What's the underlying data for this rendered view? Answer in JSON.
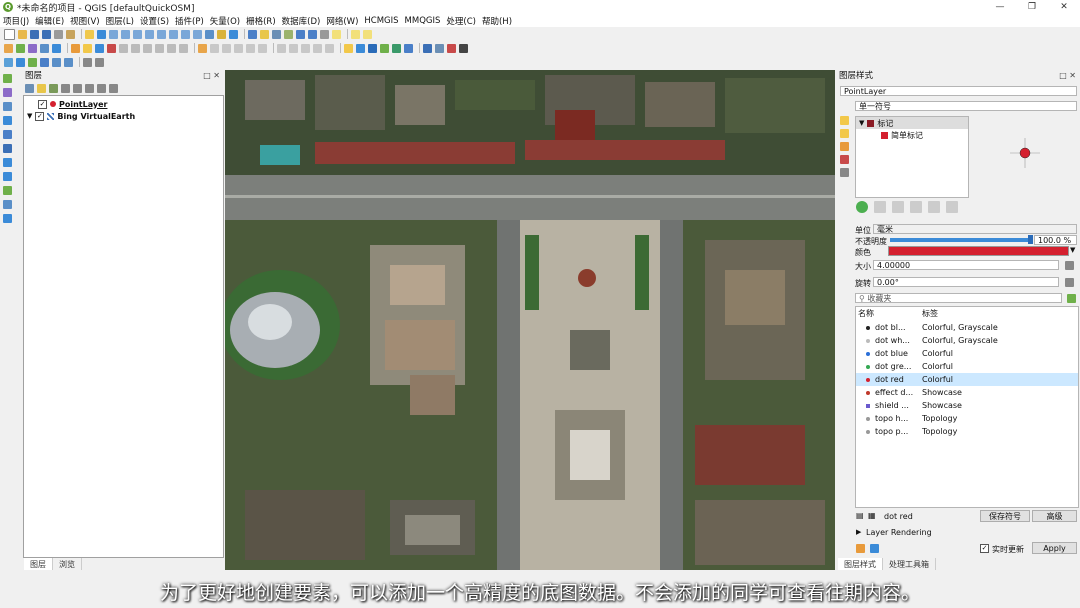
{
  "window": {
    "title": "*未命名的项目 - QGIS [defaultQuickOSM]",
    "app_icon": "Q"
  },
  "menu": [
    "项目(J)",
    "编辑(E)",
    "视图(V)",
    "图层(L)",
    "设置(S)",
    "插件(P)",
    "矢量(O)",
    "栅格(R)",
    "数据库(D)",
    "网络(W)",
    "HCMGIS",
    "MMQGIS",
    "处理(C)",
    "帮助(H)"
  ],
  "layers_panel": {
    "title": "图层",
    "items": [
      {
        "name": "PointLayer",
        "checked": true,
        "symbol_color": "#d4202f"
      },
      {
        "name": "Bing VirtualEarth",
        "checked": true
      }
    ],
    "tabs": [
      "图层",
      "浏览"
    ]
  },
  "style_panel": {
    "title": "图层样式",
    "layer_select": "PointLayer",
    "renderer": "单一符号",
    "tree": {
      "root": "标记",
      "child": "简单标记"
    },
    "unit_label": "单位",
    "unit_value": "毫米",
    "opacity_label": "不透明度",
    "opacity_value": "100.0 %",
    "color_label": "颜色",
    "color_value": "#d4202f",
    "size_label": "大小",
    "size_value": "4.00000",
    "rotation_label": "旋转",
    "rotation_value": "0.00°",
    "favorites_placeholder": "收藏夹",
    "col_name": "名称",
    "col_label": "标签",
    "symbols": [
      {
        "name": "dot  bl...",
        "tag": "Colorful, Grayscale",
        "color": "#222222"
      },
      {
        "name": "dot  wh...",
        "tag": "Colorful, Grayscale",
        "color": "#bbbbbb"
      },
      {
        "name": "dot blue",
        "tag": "Colorful",
        "color": "#2b6fd8"
      },
      {
        "name": "dot gre...",
        "tag": "Colorful",
        "color": "#34a853"
      },
      {
        "name": "dot red",
        "tag": "Colorful",
        "color": "#d4202f"
      },
      {
        "name": "effect d...",
        "tag": "Showcase",
        "color": "#c0392b"
      },
      {
        "name": "shield ...",
        "tag": "Showcase",
        "color": "#6a5acd"
      },
      {
        "name": "topo h...",
        "tag": "Topology",
        "color": "#999999"
      },
      {
        "name": "topo p...",
        "tag": "Topology",
        "color": "#999999"
      }
    ],
    "selected_symbol_name": "dot red",
    "save_symbol": "保存符号",
    "advanced": "高级",
    "layer_rendering": "Layer Rendering",
    "live_update": "实时更新",
    "apply": "Apply",
    "tabs": [
      "图层样式",
      "处理工具箱"
    ]
  },
  "subtitle": "为了更好地创建要素，可以添加一个高精度的底图数据。不会添加的同学可查看往期内容。"
}
